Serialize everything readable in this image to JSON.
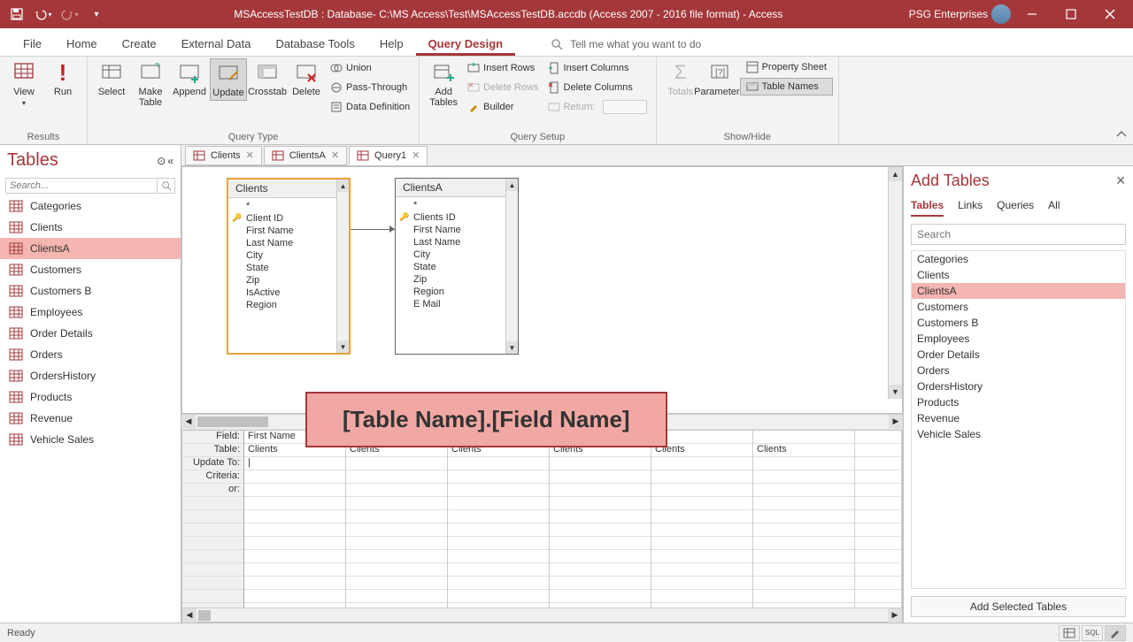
{
  "titlebar": {
    "title": "MSAccessTestDB : Database- C:\\MS Access\\Test\\MSAccessTestDB.accdb (Access 2007 - 2016 file format) - Access",
    "org": "PSG Enterprises"
  },
  "ribbon_tabs": {
    "file": "File",
    "home": "Home",
    "create": "Create",
    "external": "External Data",
    "dbtools": "Database Tools",
    "help": "Help",
    "qdesign": "Query Design",
    "tellme": "Tell me what you want to do"
  },
  "ribbon": {
    "results": {
      "view": "View",
      "run": "Run",
      "label": "Results"
    },
    "qtype": {
      "select": "Select",
      "maketable": "Make\nTable",
      "append": "Append",
      "update": "Update",
      "crosstab": "Crosstab",
      "delete": "Delete",
      "union": "Union",
      "passthrough": "Pass-Through",
      "datadef": "Data Definition",
      "label": "Query Type"
    },
    "qsetup": {
      "addtables": "Add\nTables",
      "insrows": "Insert Rows",
      "delrows": "Delete Rows",
      "builder": "Builder",
      "inscols": "Insert Columns",
      "delcols": "Delete Columns",
      "return": "Return:",
      "label": "Query Setup"
    },
    "showhide": {
      "totals": "Totals",
      "params": "Parameters",
      "propsheet": "Property Sheet",
      "tablenames": "Table Names",
      "label": "Show/Hide"
    }
  },
  "nav": {
    "title": "Tables",
    "search_ph": "Search...",
    "items": [
      "Categories",
      "Clients",
      "ClientsA",
      "Customers",
      "Customers B",
      "Employees",
      "Order Details",
      "Orders",
      "OrdersHistory",
      "Products",
      "Revenue",
      "Vehicle Sales"
    ],
    "selected": "ClientsA"
  },
  "doc_tabs": [
    {
      "label": "Clients",
      "active": false
    },
    {
      "label": "ClientsA",
      "active": false
    },
    {
      "label": "Query1",
      "active": true
    }
  ],
  "designer": {
    "table1": {
      "name": "Clients",
      "fields": [
        "*",
        "Client ID",
        "First Name",
        "Last Name",
        "City",
        "State",
        "Zip",
        "IsActive",
        "Region"
      ],
      "key": 1
    },
    "table2": {
      "name": "ClientsA",
      "fields": [
        "*",
        "Clients ID",
        "First Name",
        "Last Name",
        "City",
        "State",
        "Zip",
        "Region",
        "E Mail"
      ],
      "key": 1
    }
  },
  "callout": "[Table Name].[Field Name]",
  "qbe": {
    "labels": [
      "Field:",
      "Table:",
      "Update To:",
      "Criteria:",
      "or:"
    ],
    "cols": [
      {
        "field": "First Name",
        "table": "Clients"
      },
      {
        "field": "",
        "table": "Clients"
      },
      {
        "field": "",
        "table": "Clients"
      },
      {
        "field": "",
        "table": "Clients"
      },
      {
        "field": "",
        "table": "Clients"
      },
      {
        "field": "",
        "table": "Clients"
      }
    ]
  },
  "add_pane": {
    "title": "Add Tables",
    "tabs": {
      "tables": "Tables",
      "links": "Links",
      "queries": "Queries",
      "all": "All"
    },
    "search_ph": "Search",
    "items": [
      "Categories",
      "Clients",
      "ClientsA",
      "Customers",
      "Customers B",
      "Employees",
      "Order Details",
      "Orders",
      "OrdersHistory",
      "Products",
      "Revenue",
      "Vehicle Sales"
    ],
    "selected": "ClientsA",
    "button": "Add Selected Tables"
  },
  "status": {
    "ready": "Ready",
    "sql": "SQL"
  }
}
